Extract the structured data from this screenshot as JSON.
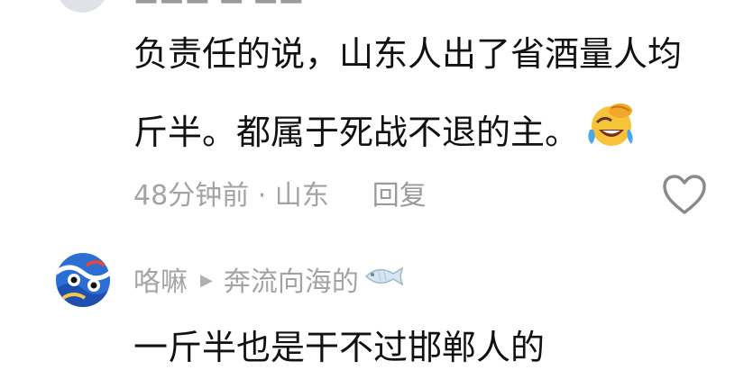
{
  "comment1": {
    "line1": "负责任的说，山东人出了省酒量人均",
    "line2": "斤半。都属于死战不退的主。",
    "time": "48分钟前 · 山东",
    "reply": "回复"
  },
  "comment2": {
    "username": "咯嘛",
    "reply_to": "奔流向海的",
    "text": "一斤半也是干不过邯郸人的"
  },
  "icons": {
    "emoji": "laughing-tears-emoji",
    "like": "heart-outline-icon",
    "arrow": "play-arrow-icon",
    "fish": "fish-icon"
  }
}
